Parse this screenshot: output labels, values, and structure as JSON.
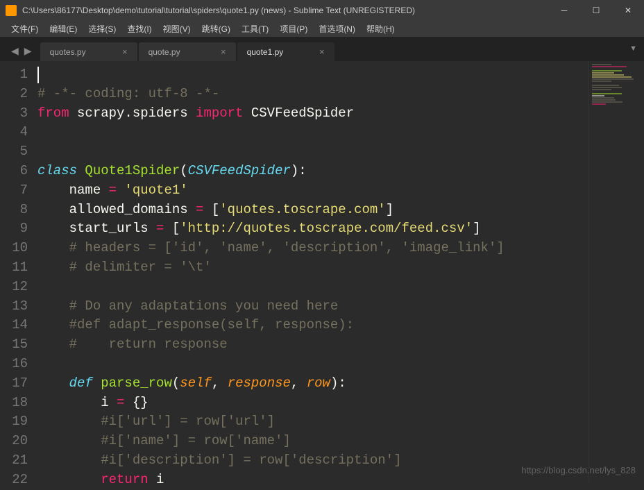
{
  "window": {
    "title": "C:\\Users\\86177\\Desktop\\demo\\tutorial\\tutorial\\spiders\\quote1.py (news) - Sublime Text (UNREGISTERED)"
  },
  "menu": {
    "file": "文件(F)",
    "edit": "编辑(E)",
    "select": "选择(S)",
    "find": "查找(I)",
    "view": "视图(V)",
    "goto": "跳转(G)",
    "tools": "工具(T)",
    "project": "项目(P)",
    "prefs": "首选项(N)",
    "help": "帮助(H)"
  },
  "tabs": {
    "t1": "quotes.py",
    "t2": "quote.py",
    "t3": "quote1.py"
  },
  "code": {
    "l1_comment": "# -*- coding: utf-8 -*-",
    "l2_from": "from",
    "l2_module": " scrapy.spiders ",
    "l2_import": "import",
    "l2_name": " CSVFeedSpider",
    "l5_class": "class",
    "l5_name": " Quote1Spider",
    "l5_paren_open": "(",
    "l5_inherit": "CSVFeedSpider",
    "l5_paren_close": "):",
    "l6_indent": "    ",
    "l6_var": "name ",
    "l6_eq": "=",
    "l6_val": " 'quote1'",
    "l7_var": "allowed_domains ",
    "l7_eq": "=",
    "l7_open": " [",
    "l7_val": "'quotes.toscrape.com'",
    "l7_close": "]",
    "l8_var": "start_urls ",
    "l8_eq": "=",
    "l8_open": " [",
    "l8_val": "'http://quotes.toscrape.com/feed.csv'",
    "l8_close": "]",
    "l9": "    # headers = ['id', 'name', 'description', 'image_link']",
    "l10": "    # delimiter = '\\t'",
    "l12": "    # Do any adaptations you need here",
    "l13": "    #def adapt_response(self, response):",
    "l14": "    #    return response",
    "l16_def": "def",
    "l16_fn": " parse_row",
    "l16_paren": "(",
    "l16_p1": "self",
    "l16_c1": ", ",
    "l16_p2": "response",
    "l16_c2": ", ",
    "l16_p3": "row",
    "l16_close": "):",
    "l17_indent": "        ",
    "l17_var": "i ",
    "l17_eq": "=",
    "l17_val": " {}",
    "l18": "        #i['url'] = row['url']",
    "l19": "        #i['name'] = row['name']",
    "l20": "        #i['description'] = row['description']",
    "l21_ret": "return",
    "l21_var": " i"
  },
  "lines": {
    "n1": "1",
    "n2": "2",
    "n3": "3",
    "n4": "4",
    "n5": "5",
    "n6": "6",
    "n7": "7",
    "n8": "8",
    "n9": "9",
    "n10": "10",
    "n11": "11",
    "n12": "12",
    "n13": "13",
    "n14": "14",
    "n15": "15",
    "n16": "16",
    "n17": "17",
    "n18": "18",
    "n19": "19",
    "n20": "20",
    "n21": "21",
    "n22": "22"
  },
  "watermark": "https://blog.csdn.net/lys_828"
}
